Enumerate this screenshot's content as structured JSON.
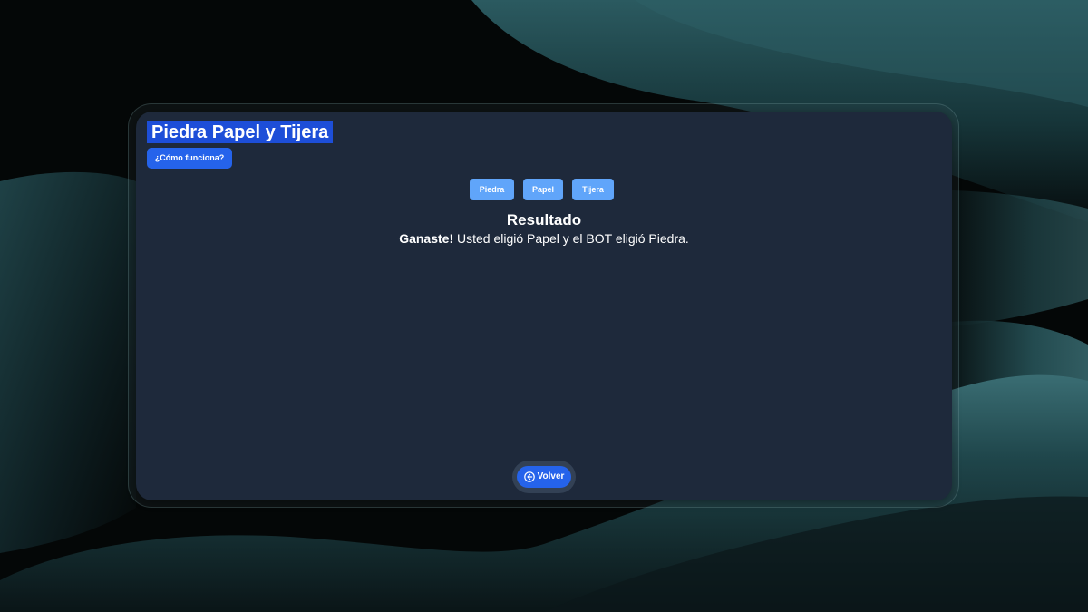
{
  "app": {
    "title": "Piedra Papel y Tijera",
    "help_button": "¿Cómo funciona?"
  },
  "choices": {
    "rock": "Piedra",
    "paper": "Papel",
    "scissors": "Tijera"
  },
  "result": {
    "heading": "Resultado",
    "outcome": "Ganaste!",
    "detail": " Usted eligió Papel y el BOT eligió Piedra."
  },
  "footer": {
    "back_label": "Volver",
    "back_icon": "arrow-left-circle-icon"
  },
  "colors": {
    "panel": "#1e293b",
    "title_highlight": "#1d4ed8",
    "primary_button": "#2563eb",
    "choice_button": "#60a5fa",
    "background": "#040707",
    "wave": "#1f4a4f"
  }
}
